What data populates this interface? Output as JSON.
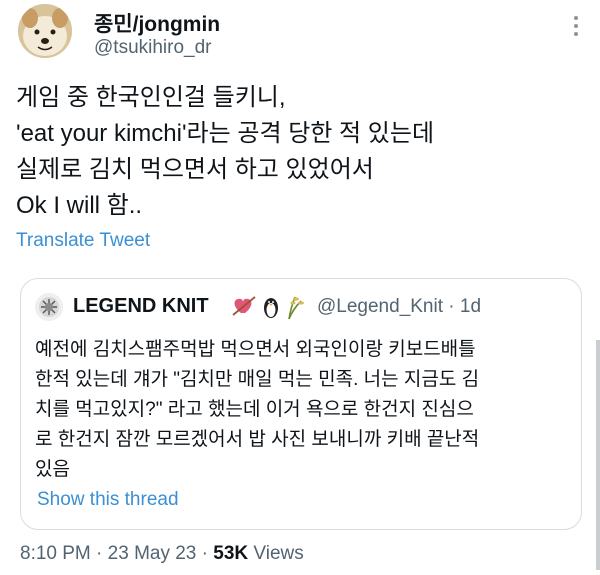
{
  "tweet": {
    "author_name": "종민/jongmin",
    "author_handle": "@tsukihiro_dr",
    "lines": [
      "게임 중 한국인인걸 들키니,",
      "'eat your kimchi'라는 공격 당한 적 있는데",
      "실제로 김치 먹으면서 하고 있었어서",
      "Ok I will 함.."
    ],
    "translate_label": "Translate Tweet",
    "time": "8:10 PM",
    "date": "23 May 23",
    "views_count": "53K",
    "views_label": "Views",
    "separator": "·"
  },
  "quoted": {
    "author_name": "LEGEND KNIT",
    "emoji": "💘🐧🌾",
    "author_handle": "@Legend_Knit",
    "age": "1d",
    "lines": [
      "예전에 김치스팸주먹밥 먹으면서 외국인이랑 키보드배틀",
      "한적 있는데 걔가 \"김치만 매일 먹는 민족. 너는 지금도 김",
      "치를 먹고있지?\" 라고 했는데 이거 욕으로 한건지 진심으",
      "로 한건지 잠깐 모르겠어서 밥 사진 보내니까 키배 끝난적",
      "있음"
    ],
    "show_thread_label": "Show this thread"
  },
  "icons": {
    "more": "more-dots-icon",
    "avatar": "dog-avatar",
    "quoted_avatar": "knit-avatar"
  },
  "colors": {
    "link": "#3b8fd4",
    "secondary_text": "#536471",
    "border": "#d7dde2"
  }
}
